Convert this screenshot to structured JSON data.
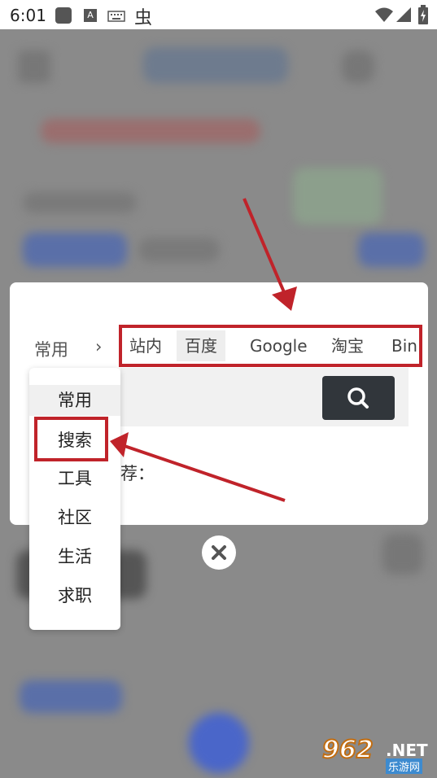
{
  "status_bar": {
    "time": "6:01",
    "icons": [
      "square-app-icon",
      "a-badge-icon",
      "keyboard-icon",
      "bug-icon",
      "wifi-icon",
      "signal-icon",
      "battery-charging-icon"
    ]
  },
  "dialog": {
    "category_current": "常用",
    "category_chevron": "›",
    "tabs": [
      "站内",
      "百度",
      "Google",
      "淘宝",
      "Bin"
    ],
    "active_tab": "百度",
    "search_button_icon": "search-icon",
    "recommend_label": "荐："
  },
  "category_menu": {
    "items": [
      "常用",
      "搜索",
      "工具",
      "社区",
      "生活",
      "求职"
    ],
    "active": "常用",
    "highlighted": "搜索"
  },
  "close_button_icon": "close-icon",
  "annotation_color": "#c0232a",
  "watermark": {
    "number": "962",
    "net": ".NET",
    "subtitle": "乐游网"
  }
}
